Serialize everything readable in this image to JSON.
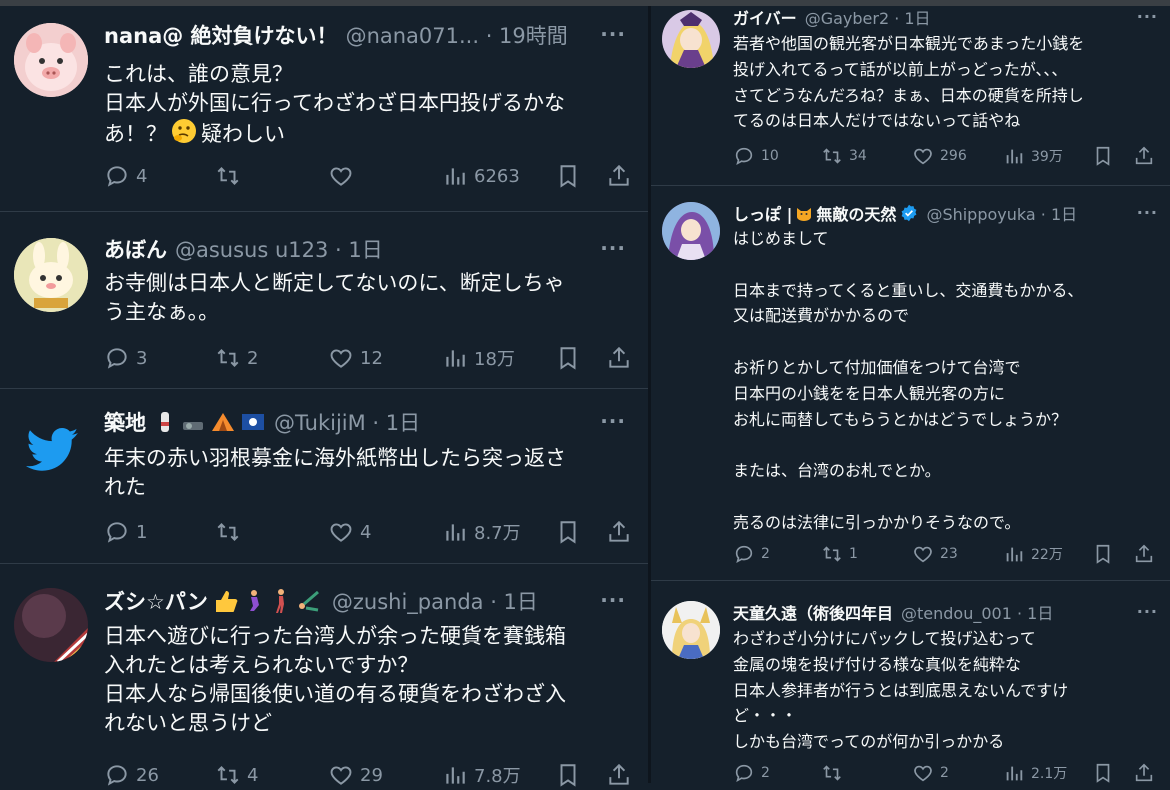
{
  "left_tweets": [
    {
      "name": "nana@ 絶対負けない！",
      "handle": "@nana071... · 19時間",
      "text": "これは、誰の意見？\n日本人が外国に行ってわざわざ日本円投げるかな\nあ！？",
      "text_suffix": "疑わしい",
      "replies": "4",
      "retweets": "",
      "likes": "",
      "views": "6263",
      "avatar_icon": "pig-avatar"
    },
    {
      "name": "あぼん",
      "handle": "@asusus u123 · 1日",
      "text": "お寺側は日本人と断定してないのに、断定しちゃ\nう主なぁ。。",
      "replies": "3",
      "retweets": "2",
      "likes": "12",
      "views": "18万",
      "avatar_icon": "rabbit-avatar"
    },
    {
      "name": "築地",
      "handle": "@TukijiM · 1日",
      "text": "年末の赤い羽根募金に海外紙幣出したら突っ返さ\nれた",
      "replies": "1",
      "retweets": "",
      "likes": "4",
      "views": "8.7万",
      "avatar_icon": "twitter-bird-avatar"
    },
    {
      "name": "ズシ☆パン",
      "handle": "@zushi_panda · 1日",
      "text": "日本へ遊びに行った台湾人が余った硬貨を賽銭箱\n入れたとは考えられないですか？\n日本人なら帰国後使い道の有る硬貨をわざわざ入\nれないと思うけど",
      "replies": "26",
      "retweets": "4",
      "likes": "29",
      "views": "7.8万",
      "avatar_icon": "planet-avatar"
    }
  ],
  "right_tweets": [
    {
      "name": "ガイバー",
      "handle": "@Gayber2 · 1日",
      "text": "若者や他国の観光客が日本観光であまった小銭を\n投げ入れてるって話が以前上がっどったが、、、\nさてどうなんだろね？まぁ、日本の硬貨を所持し\nてるのは日本人だけではないって話やね",
      "replies": "10",
      "retweets": "34",
      "likes": "296",
      "views": "39万",
      "avatar_icon": "anime-girl-avatar"
    },
    {
      "name": "しっぽ | ",
      "name2": "無敵の天然",
      "handle": "@Shippoyuka · 1日",
      "text": "はじめまして\n\n日本まで持ってくると重いし、交通費もかかる、\n又は配送費がかかるので\n\nお祈りとかして付加価値をつけて台湾で\n日本円の小銭をを日本人観光客の方に\nお札に両替してもらうとかはどうでしょうか？\n\nまたは、台湾のお札でとか。\n\n売るのは法律に引っかかりそうなので。",
      "replies": "2",
      "retweets": "1",
      "likes": "23",
      "views": "22万",
      "avatar_icon": "anime-girl-purple-avatar"
    },
    {
      "name": "天童久遠（術後四年目",
      "handle": "@tendou_001 · 1日",
      "text": "わざわざ小分けにパックして投げ込むって\n金属の塊を投げ付ける様な真似を純粋な\n日本人参拝者が行うとは到底思えないんですけ\nど・・・\nしかも台湾でってのが何か引っかかる",
      "replies": "2",
      "retweets": "",
      "likes": "2",
      "views": "2.1万",
      "avatar_icon": "fox-girl-avatar"
    }
  ],
  "colors": {
    "bg": "#15202b",
    "text": "#f7f9f9",
    "muted": "#8b98a5",
    "verified": "#1d9bf0",
    "divider": "#2f3b47"
  },
  "more_label": "···"
}
